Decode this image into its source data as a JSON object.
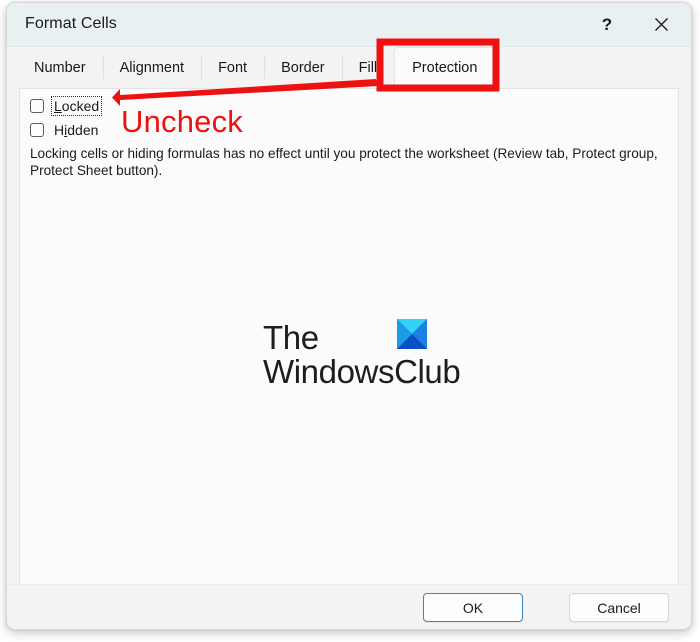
{
  "dialog": {
    "title": "Format Cells",
    "help_icon": "question-mark-icon",
    "help_label": "?",
    "close_icon": "close-icon"
  },
  "tabs": [
    {
      "label": "Number",
      "selected": false
    },
    {
      "label": "Alignment",
      "selected": false
    },
    {
      "label": "Font",
      "selected": false
    },
    {
      "label": "Border",
      "selected": false
    },
    {
      "label": "Fill",
      "selected": false
    },
    {
      "label": "Protection",
      "selected": true
    }
  ],
  "protection_panel": {
    "checkboxes": [
      {
        "label": "Locked",
        "accelerator": "L",
        "checked": false,
        "focused": true
      },
      {
        "label": "Hidden",
        "accelerator": "i",
        "checked": false,
        "focused": false
      }
    ],
    "description": "Locking cells or hiding formulas has no effect until you protect the worksheet (Review tab, Protect group, Protect Sheet button)."
  },
  "watermark": {
    "line1": "The",
    "line2": "WindowsClub",
    "logo_icon": "windowsclub-logo-icon",
    "logo_colors": {
      "top": "#35d2f5",
      "left": "#1e86e8",
      "right": "#1e86e8",
      "bottom": "#0b4fc4"
    }
  },
  "footer": {
    "ok_label": "OK",
    "cancel_label": "Cancel"
  },
  "annotations": {
    "callout_text": "Uncheck",
    "highlight_color": "#ee1111",
    "highlight_target": "Protection",
    "arrow_target": "Locked"
  }
}
